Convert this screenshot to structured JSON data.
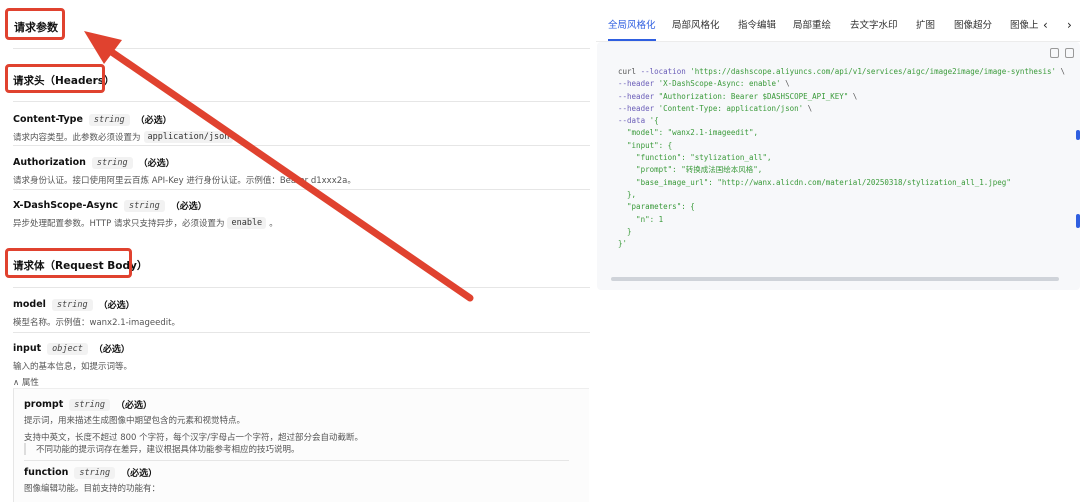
{
  "left": {
    "title_main": "请求参数",
    "title_headers": "请求头（Headers）",
    "title_body": "请求体（Request Body）",
    "headers": [
      {
        "name": "Content-Type",
        "type": "string",
        "required": "（必选）",
        "desc_pre": "请求内容类型。此参数必须设置为",
        "desc_code": "application/json",
        "desc_post": "。"
      },
      {
        "name": "Authorization",
        "type": "string",
        "required": "（必选）",
        "desc_pre": "请求身份认证。接口使用阿里云百炼 API-Key 进行身份认证。示例值：Bearer d1xxx2a。"
      },
      {
        "name": "X-DashScope-Async",
        "type": "string",
        "required": "（必选）",
        "desc_pre": "异步处理配置参数。HTTP 请求只支持异步，必须设置为",
        "desc_code": "enable",
        "desc_post": "。"
      }
    ],
    "body": [
      {
        "name": "model",
        "type": "string",
        "required": "（必选）",
        "desc_pre": "模型名称。示例值：wanx2.1-imageedit。"
      },
      {
        "name": "input",
        "type": "object",
        "required": "（必选）",
        "desc_pre": "输入的基本信息，如提示词等。"
      }
    ],
    "attr_toggle": "∧ 属性",
    "nested": {
      "prompt": {
        "name": "prompt",
        "type": "string",
        "required": "（必选）",
        "line1": "提示词，用来描述生成图像中期望包含的元素和视觉特点。",
        "line2": "支持中英文，长度不超过 800 个字符，每个汉字/字母占一个字符，超过部分会自动截断。",
        "quote": "不同功能的提示词存在差异，建议根据具体功能参考相应的技巧说明。"
      },
      "function": {
        "name": "function",
        "type": "string",
        "required": "（必选）",
        "line1": "图像编辑功能。目前支持的功能有："
      }
    }
  },
  "tabs": {
    "items": [
      "全局风格化",
      "局部风格化",
      "指令编辑",
      "局部重绘",
      "去文字水印",
      "扩图",
      "图像超分",
      "图像上"
    ],
    "active": "全局风格化",
    "prev": "‹",
    "next": "›"
  },
  "code": {
    "lines": [
      [
        [
          "c-cmd",
          "curl "
        ],
        [
          "c-flag",
          "--location "
        ],
        [
          "c-str",
          "'https://dashscope.aliyuncs.com/api/v1/services/aigc/image2image/image-synthesis'"
        ],
        [
          "c-cmd",
          " \\"
        ]
      ],
      [
        [
          "c-flag",
          "--header "
        ],
        [
          "c-str",
          "'X-DashScope-Async: enable'"
        ],
        [
          "c-cmd",
          " \\"
        ]
      ],
      [
        [
          "c-flag",
          "--header "
        ],
        [
          "c-str",
          "\"Authorization: Bearer $DASHSCOPE_API_KEY\""
        ],
        [
          "c-cmd",
          " \\"
        ]
      ],
      [
        [
          "c-flag",
          "--header "
        ],
        [
          "c-str",
          "'Content-Type: application/json'"
        ],
        [
          "c-cmd",
          " \\"
        ]
      ],
      [
        [
          "c-flag",
          "--data "
        ],
        [
          "c-str",
          "'{"
        ]
      ],
      [
        [
          "c-str",
          "  \"model\": \"wanx2.1-imageedit\","
        ]
      ],
      [
        [
          "c-str",
          "  \"input\": {"
        ]
      ],
      [
        [
          "c-str",
          "    \"function\": \"stylization_all\","
        ]
      ],
      [
        [
          "c-str",
          "    \"prompt\": \"转换成法国绘本风格\","
        ]
      ],
      [
        [
          "c-str",
          "    \"base_image_url\": \"http://wanx.alicdn.com/material/20250318/stylization_all_1.jpeg\""
        ]
      ],
      [
        [
          "c-str",
          "  },"
        ]
      ],
      [
        [
          "c-str",
          "  \"parameters\": {"
        ]
      ],
      [
        [
          "c-str",
          "    \"n\": 1"
        ]
      ],
      [
        [
          "c-str",
          "  }"
        ]
      ],
      [
        [
          "c-str",
          "}'"
        ]
      ]
    ]
  },
  "colors": {
    "accent": "#2f5fe0",
    "annotation_red": "#e0422f",
    "code_string": "#3a9a3a",
    "code_flag": "#6a5db8"
  }
}
